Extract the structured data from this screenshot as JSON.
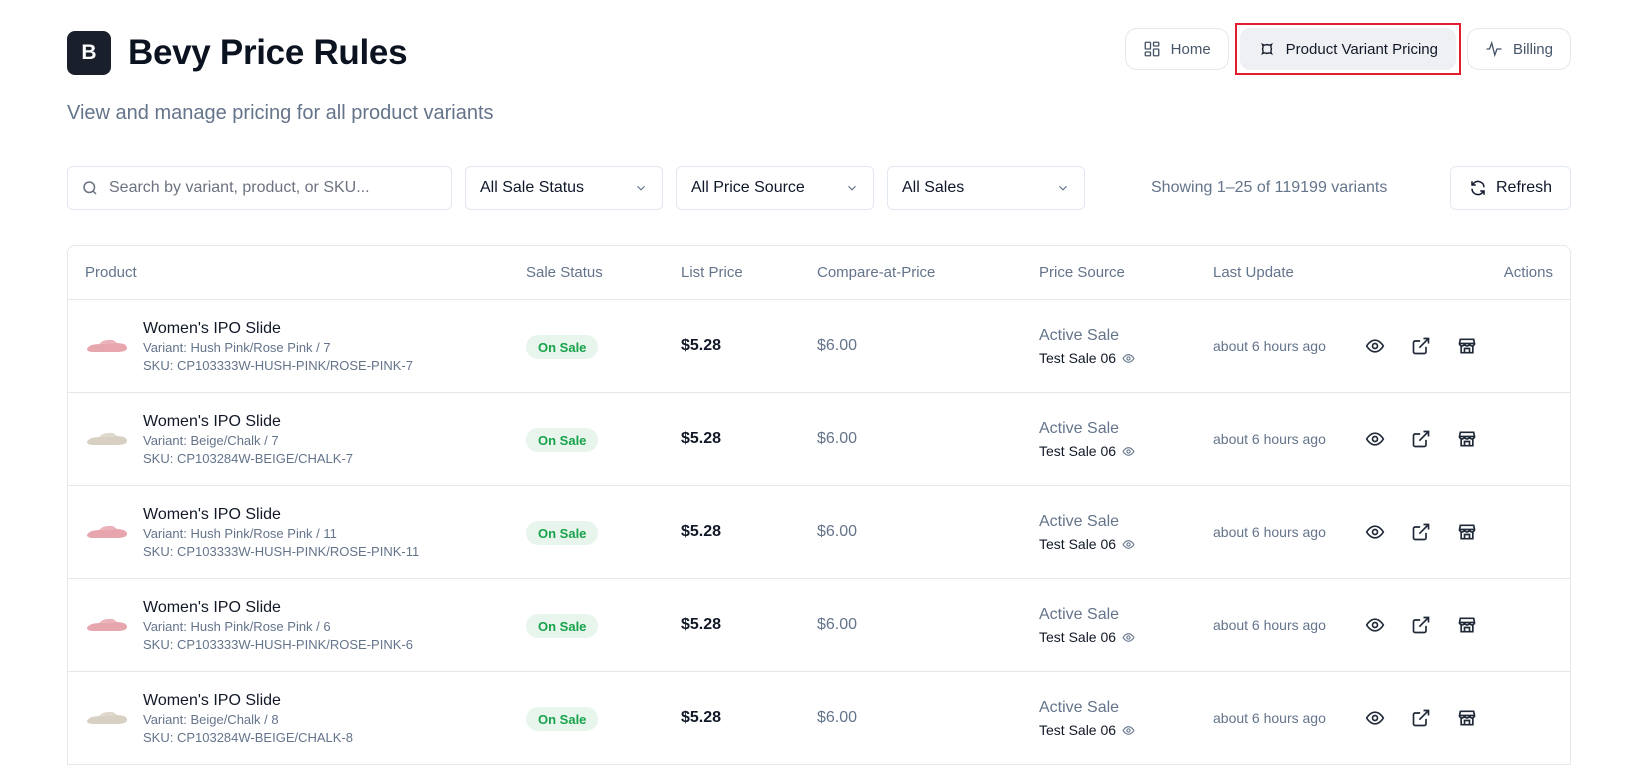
{
  "header": {
    "logo_letter": "B",
    "title": "Bevy Price Rules",
    "subtitle": "View and manage pricing for all product variants"
  },
  "nav": {
    "items": [
      {
        "label": "Home",
        "icon": "dashboard-grid-icon"
      },
      {
        "label": "Product Variant Pricing",
        "icon": "badge-icon",
        "active": true
      },
      {
        "label": "Billing",
        "icon": "activity-icon"
      }
    ]
  },
  "filters": {
    "search_placeholder": "Search by variant, product, or SKU...",
    "sale_status": "All Sale Status",
    "price_source": "All Price Source",
    "sales": "All Sales",
    "showing": "Showing 1–25 of 119199 variants",
    "refresh_label": "Refresh"
  },
  "table": {
    "columns": [
      "Product",
      "Sale Status",
      "List Price",
      "Compare-at-Price",
      "Price Source",
      "Last Update",
      "Actions"
    ],
    "rows": [
      {
        "product": "Women's IPO Slide",
        "variant": "Variant: Hush Pink/Rose Pink / 7",
        "sku": "SKU: CP103333W-HUSH-PINK/ROSE-PINK-7",
        "thumb_color": "#e7a6ad",
        "status": "On Sale",
        "list_price": "$5.28",
        "compare": "$6.00",
        "source": "Active Sale",
        "sale": "Test Sale 06",
        "updated": "about 6 hours ago"
      },
      {
        "product": "Women's IPO Slide",
        "variant": "Variant: Beige/Chalk / 7",
        "sku": "SKU: CP103284W-BEIGE/CHALK-7",
        "thumb_color": "#d8d0c2",
        "status": "On Sale",
        "list_price": "$5.28",
        "compare": "$6.00",
        "source": "Active Sale",
        "sale": "Test Sale 06",
        "updated": "about 6 hours ago"
      },
      {
        "product": "Women's IPO Slide",
        "variant": "Variant: Hush Pink/Rose Pink / 11",
        "sku": "SKU: CP103333W-HUSH-PINK/ROSE-PINK-11",
        "thumb_color": "#e7a6ad",
        "status": "On Sale",
        "list_price": "$5.28",
        "compare": "$6.00",
        "source": "Active Sale",
        "sale": "Test Sale 06",
        "updated": "about 6 hours ago"
      },
      {
        "product": "Women's IPO Slide",
        "variant": "Variant: Hush Pink/Rose Pink / 6",
        "sku": "SKU: CP103333W-HUSH-PINK/ROSE-PINK-6",
        "thumb_color": "#e7a6ad",
        "status": "On Sale",
        "list_price": "$5.28",
        "compare": "$6.00",
        "source": "Active Sale",
        "sale": "Test Sale 06",
        "updated": "about 6 hours ago"
      },
      {
        "product": "Women's IPO Slide",
        "variant": "Variant: Beige/Chalk / 8",
        "sku": "SKU: CP103284W-BEIGE/CHALK-8",
        "thumb_color": "#d8d0c2",
        "status": "On Sale",
        "list_price": "$5.28",
        "compare": "$6.00",
        "source": "Active Sale",
        "sale": "Test Sale 06",
        "updated": "about 6 hours ago"
      }
    ],
    "row_actions": [
      "view-icon",
      "external-link-icon",
      "store-icon"
    ]
  },
  "colors": {
    "highlight_border": "#e11d2e",
    "status_badge_bg": "#e8f5ec",
    "status_badge_text": "#16a34a"
  }
}
